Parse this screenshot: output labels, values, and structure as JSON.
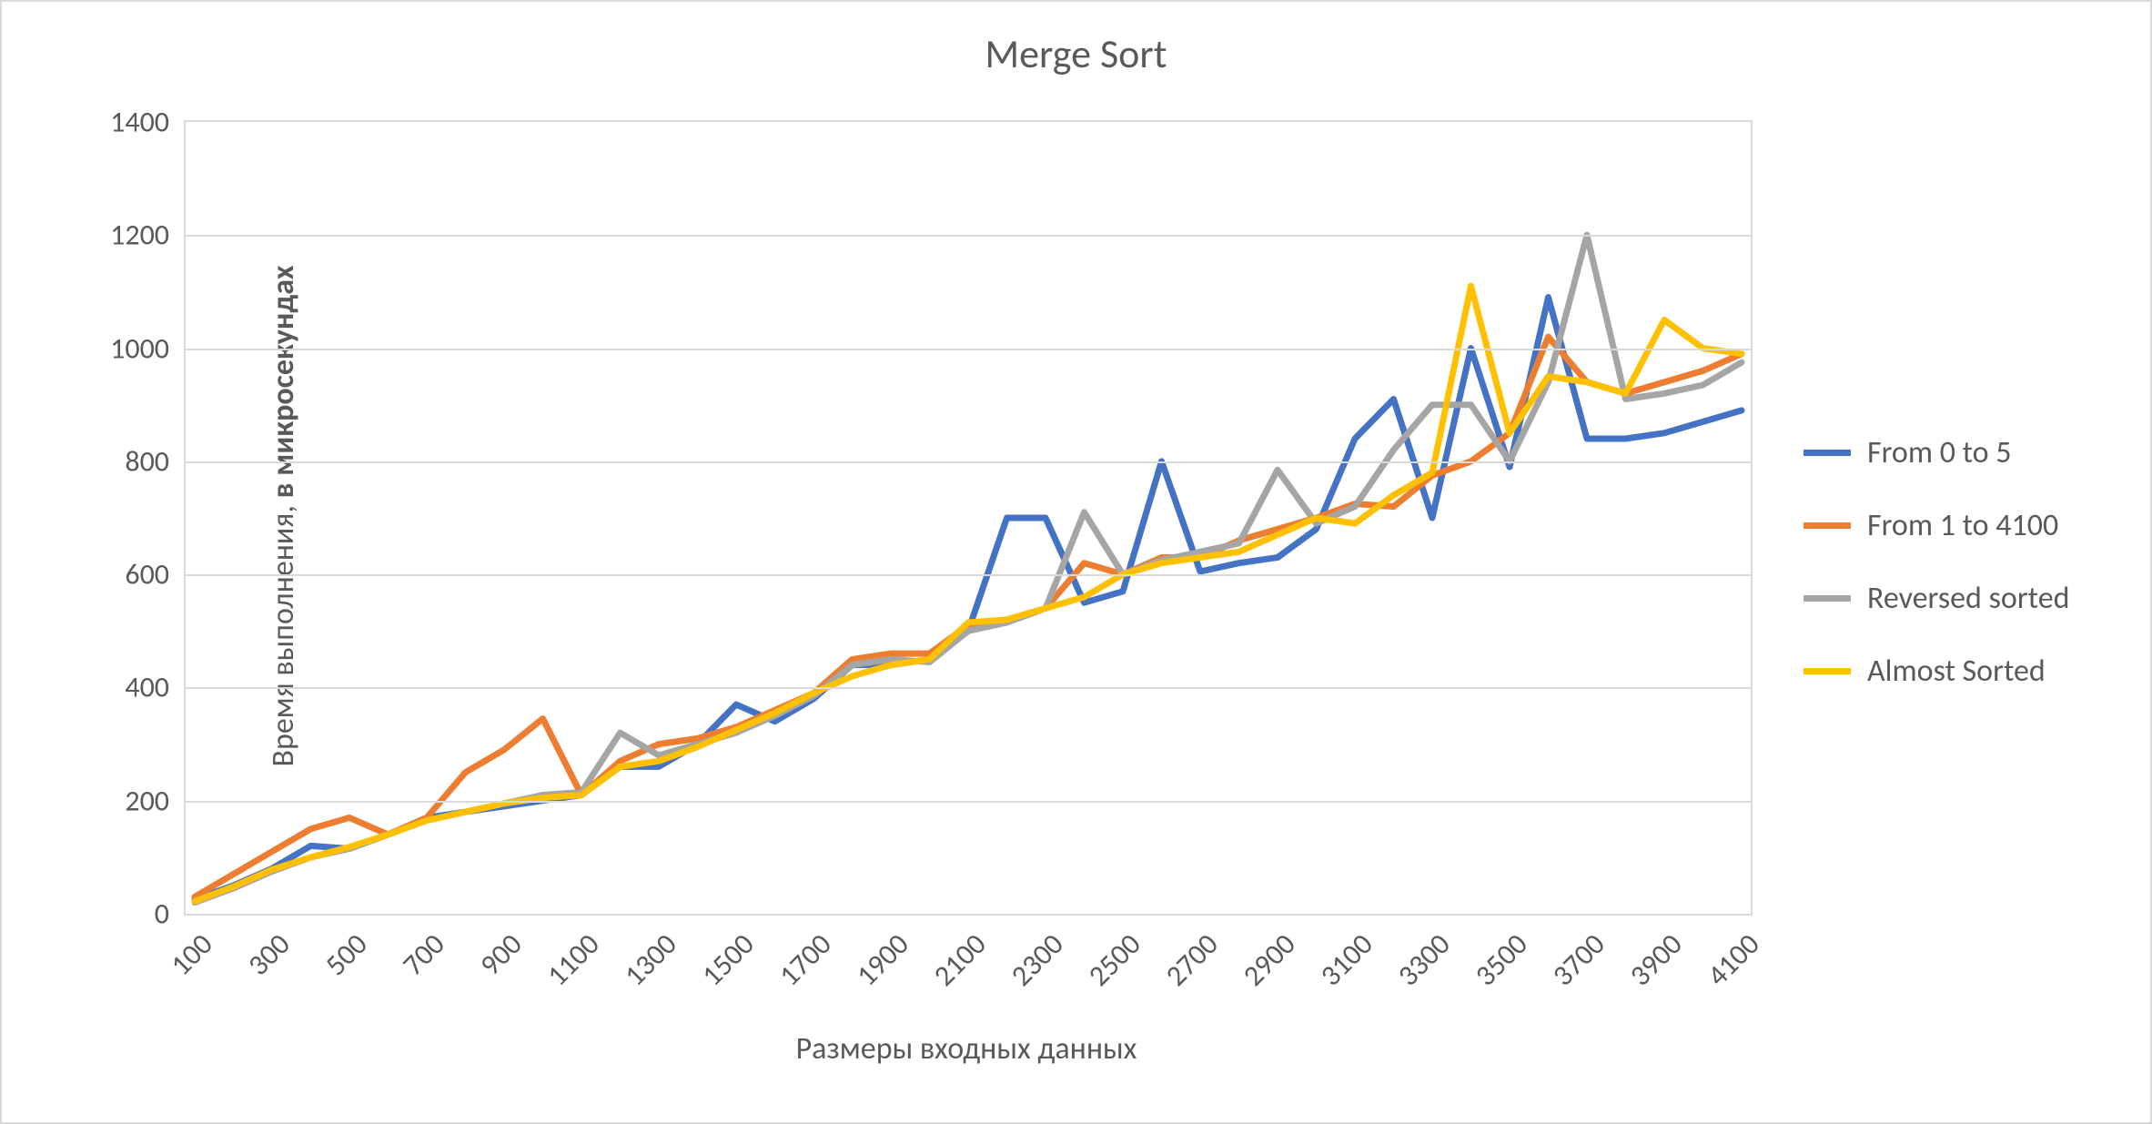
{
  "chart_data": {
    "type": "line",
    "title": "Merge Sort",
    "xlabel": "Размеры входных данных",
    "ylabel_plain": "Время выполнения, ",
    "ylabel_bold": "в микросекундах",
    "ylim": [
      0,
      1400
    ],
    "y_ticks": [
      0,
      200,
      400,
      600,
      800,
      1000,
      1200,
      1400
    ],
    "x_ticks": [
      100,
      300,
      500,
      700,
      900,
      1100,
      1300,
      1500,
      1700,
      1900,
      2100,
      2300,
      2500,
      2700,
      2900,
      3100,
      3300,
      3500,
      3700,
      3900,
      4100
    ],
    "x": [
      100,
      200,
      300,
      400,
      500,
      600,
      700,
      800,
      900,
      1000,
      1100,
      1200,
      1300,
      1400,
      1500,
      1600,
      1700,
      1800,
      1900,
      2000,
      2100,
      2200,
      2300,
      2400,
      2500,
      2600,
      2700,
      2800,
      2900,
      3000,
      3100,
      3200,
      3300,
      3400,
      3500,
      3600,
      3700,
      3800,
      3900,
      4000,
      4100
    ],
    "series": [
      {
        "name": "From 0 to 5",
        "color": "#4472C4",
        "values": [
          25,
          50,
          80,
          120,
          115,
          140,
          170,
          180,
          190,
          200,
          210,
          260,
          260,
          300,
          370,
          340,
          380,
          440,
          440,
          450,
          500,
          700,
          700,
          550,
          570,
          800,
          605,
          620,
          630,
          680,
          840,
          910,
          700,
          1000,
          790,
          1090,
          840,
          840,
          850,
          870,
          890
        ]
      },
      {
        "name": "From 1 to 4100",
        "color": "#ED7D31",
        "values": [
          30,
          70,
          110,
          150,
          170,
          140,
          170,
          250,
          290,
          345,
          210,
          270,
          300,
          310,
          330,
          360,
          390,
          450,
          460,
          460,
          510,
          520,
          540,
          620,
          600,
          630,
          630,
          660,
          680,
          700,
          725,
          720,
          775,
          800,
          850,
          1020,
          940,
          920,
          940,
          960,
          990
        ]
      },
      {
        "name": "Reversed sorted",
        "color": "#A5A5A5",
        "values": [
          20,
          45,
          75,
          100,
          115,
          140,
          165,
          180,
          195,
          210,
          215,
          320,
          280,
          300,
          320,
          350,
          385,
          440,
          450,
          445,
          500,
          515,
          540,
          710,
          600,
          625,
          640,
          655,
          785,
          690,
          720,
          820,
          900,
          900,
          800,
          940,
          1200,
          910,
          920,
          935,
          975
        ]
      },
      {
        "name": "Almost Sorted",
        "color": "#FFC000",
        "values": [
          22,
          48,
          78,
          100,
          118,
          140,
          165,
          180,
          195,
          205,
          210,
          260,
          270,
          295,
          325,
          355,
          390,
          420,
          440,
          450,
          515,
          520,
          540,
          560,
          600,
          620,
          630,
          640,
          670,
          700,
          690,
          740,
          780,
          1110,
          850,
          950,
          940,
          920,
          1050,
          1000,
          990
        ]
      }
    ],
    "legend_position": "right"
  }
}
